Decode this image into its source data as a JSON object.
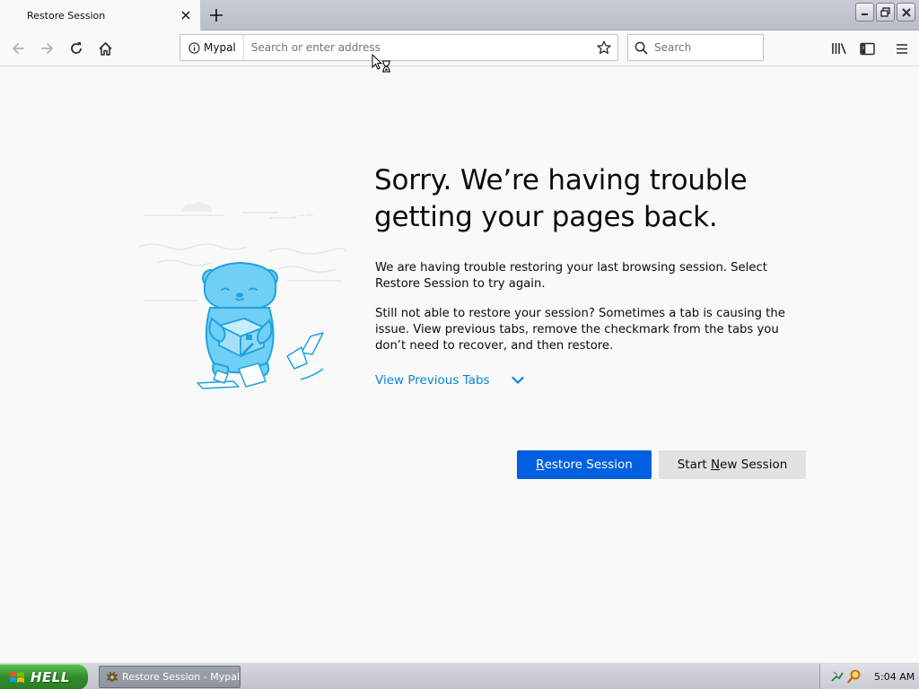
{
  "tabs": [
    {
      "label": "Restore Session",
      "active": true
    }
  ],
  "navbar": {
    "identity_label": "Mypal",
    "url_placeholder": "Search or enter address",
    "search_placeholder": "Search"
  },
  "page": {
    "title": "Sorry. We’re having trouble getting your pages back.",
    "paragraph1": "We are having trouble restoring your last browsing session. Select Restore Session to try again.",
    "paragraph2": "Still not able to restore your session? Sometimes a tab is causing the issue. View previous tabs, remove the checkmark from the tabs you don’t need to recover, and then restore.",
    "view_tabs_label": "View Previous Tabs",
    "restore_button": {
      "pre": "",
      "accel": "R",
      "post": "estore Session"
    },
    "new_session_button": {
      "pre": "Start ",
      "accel": "N",
      "post": "ew Session"
    }
  },
  "taskbar": {
    "start_label": "HELL",
    "task_label": "Restore Session - Mypal",
    "clock": "5:04 AM"
  },
  "colors": {
    "accent": "#0060df",
    "link": "#0a84d5",
    "illustration_blue": "#6fcff5",
    "illustration_stroke": "#1fa2e0"
  },
  "icons": {
    "back": "back-arrow-icon",
    "forward": "forward-arrow-icon",
    "reload": "reload-icon",
    "home": "home-icon",
    "info": "info-icon",
    "bookmark": "star-icon",
    "search": "search-icon",
    "library": "library-icon",
    "sidebar": "sidebar-icon",
    "menu": "hamburger-menu-icon"
  }
}
